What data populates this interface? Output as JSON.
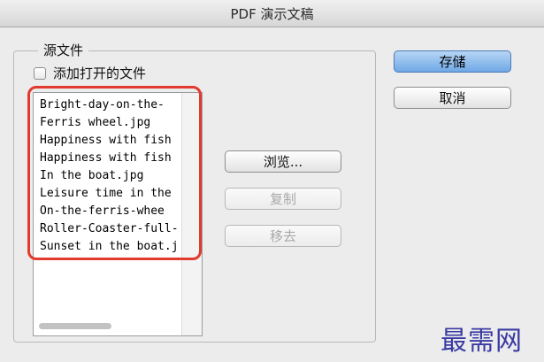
{
  "window": {
    "title": "PDF 演示文稿"
  },
  "source_group": {
    "legend": "源文件",
    "add_open_files_label": "添加打开的文件",
    "add_open_files_checked": false,
    "files": [
      "Bright-day-on-the-",
      "Ferris wheel.jpg",
      "Happiness with fish",
      "Happiness with fish",
      "In the boat.jpg",
      "Leisure time in the",
      "On-the-ferris-whee",
      "Roller-Coaster-full-",
      "Sunset in the boat.j"
    ]
  },
  "buttons": {
    "browse": "浏览...",
    "copy": "复制",
    "remove": "移去",
    "save": "存储",
    "cancel": "取消"
  },
  "watermark": "最需网",
  "colors": {
    "highlight": "#e13a2e",
    "primary_button": "#6fa8e6",
    "watermark": "#3a3aa3"
  }
}
